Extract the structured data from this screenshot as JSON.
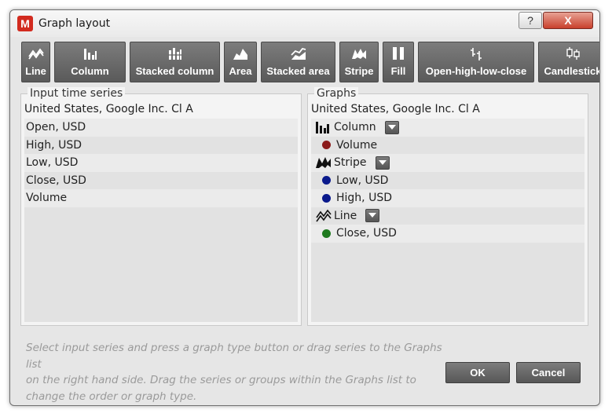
{
  "window": {
    "title": "Graph layout",
    "app_icon_letter": "M"
  },
  "titlebar": {
    "help_label": "?",
    "close_label": "X"
  },
  "toolbar": {
    "buttons": [
      {
        "label": "Line",
        "icon": "line-chart-icon"
      },
      {
        "label": "Column",
        "icon": "column-chart-icon"
      },
      {
        "label": "Stacked column",
        "icon": "stacked-column-icon"
      },
      {
        "label": "Area",
        "icon": "area-chart-icon"
      },
      {
        "label": "Stacked area",
        "icon": "stacked-area-icon"
      },
      {
        "label": "Stripe",
        "icon": "stripe-chart-icon"
      },
      {
        "label": "Fill",
        "icon": "fill-chart-icon"
      },
      {
        "label": "Open-high-low-close",
        "icon": "ohlc-icon"
      },
      {
        "label": "Candlestick",
        "icon": "candlestick-icon"
      }
    ]
  },
  "input_panel": {
    "legend": "Input time series",
    "header": "United States, Google Inc. Cl A",
    "items": [
      "Open, USD",
      "High, USD",
      "Low, USD",
      "Close, USD",
      "Volume"
    ]
  },
  "graphs_panel": {
    "legend": "Graphs",
    "header": "United States, Google Inc. Cl A",
    "groups": [
      {
        "type": "Column",
        "icon": "column-chart-icon",
        "series": [
          {
            "name": "Volume",
            "color": "#8b1a1a"
          }
        ]
      },
      {
        "type": "Stripe",
        "icon": "stripe-chart-icon",
        "series": [
          {
            "name": "Low, USD",
            "color": "#0a1a8c"
          },
          {
            "name": "High, USD",
            "color": "#0a1a8c"
          }
        ]
      },
      {
        "type": "Line",
        "icon": "line-chart-icon",
        "series": [
          {
            "name": "Close, USD",
            "color": "#1f7a1f"
          }
        ]
      }
    ]
  },
  "hint": {
    "line1": "Select input series and press a graph type button or drag series to the Graphs list",
    "line2": "on the right hand side. Drag the series or groups within the Graphs list to",
    "line3": "change the order or graph type."
  },
  "buttons": {
    "ok": "OK",
    "cancel": "Cancel"
  }
}
